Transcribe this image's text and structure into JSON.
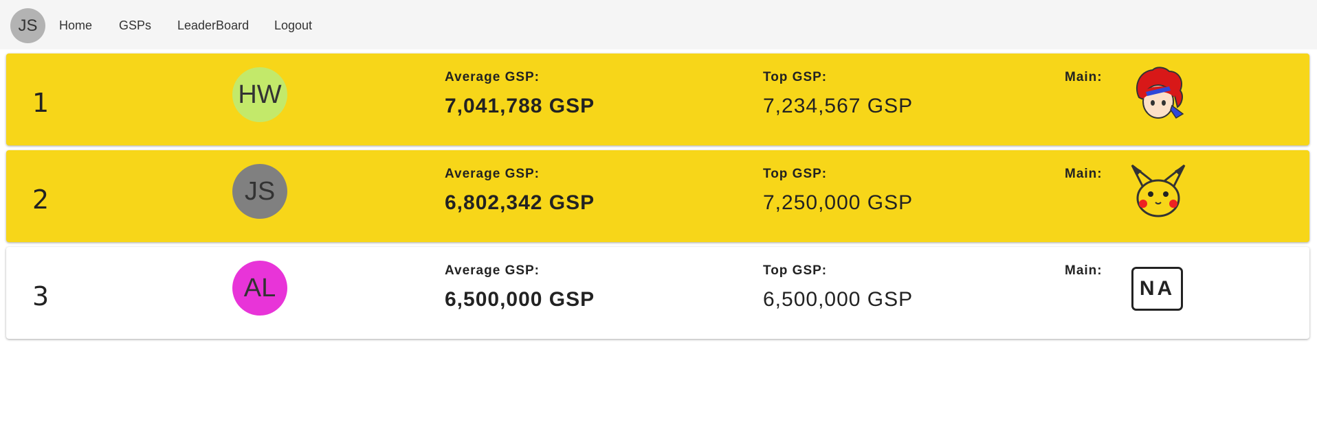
{
  "nav": {
    "user_initials": "JS",
    "links": [
      "Home",
      "GSPs",
      "LeaderBoard",
      "Logout"
    ]
  },
  "labels": {
    "average": "Average GSP:",
    "top": "Top GSP:",
    "main": "Main:"
  },
  "colors": {
    "highlight": "#f7d619",
    "plain": "#ffffff"
  },
  "leaderboard": [
    {
      "rank": "1",
      "initials": "HW",
      "avatar_color": "#c3e96a",
      "average_gsp": "7,041,788 GSP",
      "top_gsp": "7,234,567 GSP",
      "main_icon": "roy-character-icon"
    },
    {
      "rank": "2",
      "initials": "JS",
      "avatar_color": "#808080",
      "average_gsp": "6,802,342 GSP",
      "top_gsp": "7,250,000 GSP",
      "main_icon": "pikachu-character-icon"
    },
    {
      "rank": "3",
      "initials": "AL",
      "avatar_color": "#e834d8",
      "average_gsp": "6,500,000 GSP",
      "top_gsp": "6,500,000 GSP",
      "main_icon": "na-placeholder",
      "main_text": "NA"
    }
  ]
}
